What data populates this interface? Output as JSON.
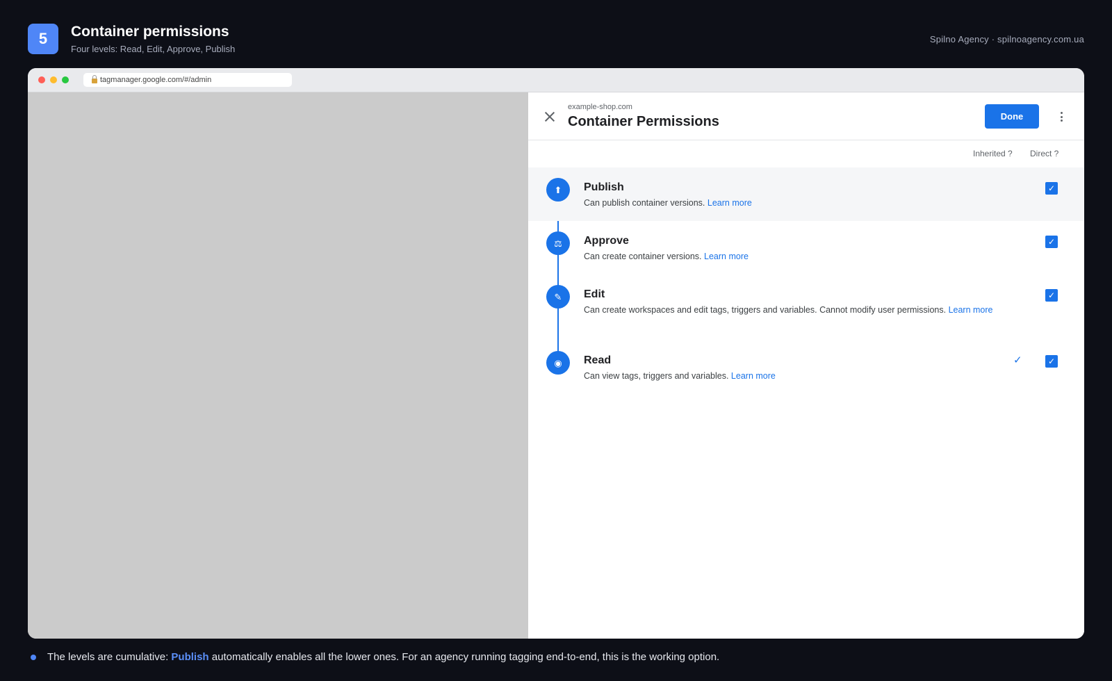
{
  "slide": {
    "step": "5",
    "title": "Container permissions",
    "subtitle": "Four levels: Read, Edit, Approve, Publish",
    "brand": "Spilno Agency · spilnoagency.com.ua"
  },
  "browser": {
    "url": "tagmanager.google.com/#/admin"
  },
  "panel": {
    "domain": "example-shop.com",
    "title": "Container Permissions",
    "done_label": "Done",
    "col_inherited": "Inherited ?",
    "col_direct": "Direct ?",
    "permissions": [
      {
        "name": "Publish",
        "description": "Can publish container versions.",
        "learn_more": "Learn more",
        "icon": "upload-icon",
        "icon_glyph": "⬆",
        "inherited": "",
        "direct_checked": "✓"
      },
      {
        "name": "Approve",
        "description": "Can create container versions.",
        "learn_more": "Learn more",
        "icon": "approve-icon",
        "icon_glyph": "⚖",
        "inherited": "",
        "direct_checked": "✓"
      },
      {
        "name": "Edit",
        "description": "Can create workspaces and edit tags, triggers and variables. Cannot modify user permissions.",
        "learn_more": "Learn more",
        "icon": "pencil-icon",
        "icon_glyph": "✎",
        "inherited": "",
        "direct_checked": "✓"
      },
      {
        "name": "Read",
        "description": "Can view tags, triggers and variables.",
        "learn_more": "Learn more",
        "icon": "eye-icon",
        "icon_glyph": "◉",
        "inherited": "✓",
        "direct_checked": "✓"
      }
    ]
  },
  "footnote": {
    "before": "The levels are cumulative:",
    "highlight": "Publish",
    "after": "automatically enables all the lower ones. For an agency running tagging end-to-end, this is the working option."
  },
  "colors": {
    "accent": "#1a73e8",
    "slide_accent": "#4f86f7",
    "background": "#0d0f17"
  }
}
